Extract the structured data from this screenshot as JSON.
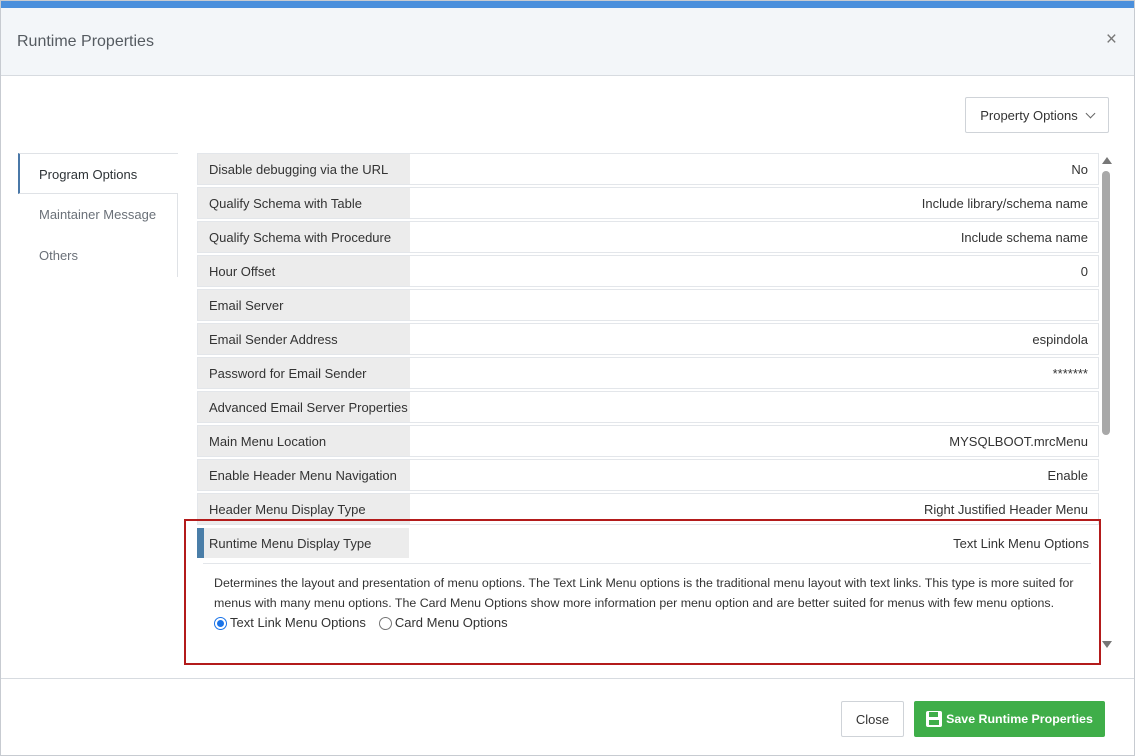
{
  "colors": {
    "accent_bar": "#4a8fdc",
    "highlight_border": "#b31b1b",
    "save_green": "#3fae49",
    "selected_marker": "#4a7ea8"
  },
  "dialog": {
    "title": "Runtime Properties",
    "close_glyph": "×"
  },
  "toolbar": {
    "property_options_label": "Property Options"
  },
  "nav": {
    "items": [
      {
        "label": "Program Options",
        "active": true
      },
      {
        "label": "Maintainer Message",
        "active": false
      },
      {
        "label": "Others",
        "active": false
      }
    ]
  },
  "properties": [
    {
      "label": "Disable debugging via the URL",
      "value": "No"
    },
    {
      "label": "Qualify Schema with Table",
      "value": "Include library/schema name"
    },
    {
      "label": "Qualify Schema with Procedure",
      "value": "Include schema name"
    },
    {
      "label": "Hour Offset",
      "value": "0"
    },
    {
      "label": "Email Server",
      "value": ""
    },
    {
      "label": "Email Sender Address",
      "value": "espindola"
    },
    {
      "label": "Password for Email Sender",
      "value": "*******"
    },
    {
      "label": "Advanced Email Server Properties",
      "value": ""
    },
    {
      "label": "Main Menu Location",
      "value": "MYSQLBOOT.mrcMenu"
    },
    {
      "label": "Enable Header Menu Navigation",
      "value": "Enable"
    },
    {
      "label": "Header Menu Display Type",
      "value": "Right Justified Header Menu"
    }
  ],
  "selected_property": {
    "label": "Runtime Menu Display Type",
    "value": "Text Link Menu Options",
    "description": "Determines the layout and presentation of menu options. The Text Link Menu options is the traditional menu layout with text links. This type is more suited for menus with many menu options. The Card Menu Options show more information per menu option and are better suited for menus with few menu options.",
    "options": [
      {
        "label": "Text Link Menu Options",
        "checked": true
      },
      {
        "label": "Card Menu Options",
        "checked": false
      }
    ]
  },
  "footer": {
    "close_label": "Close",
    "save_label": "Save Runtime Properties"
  }
}
